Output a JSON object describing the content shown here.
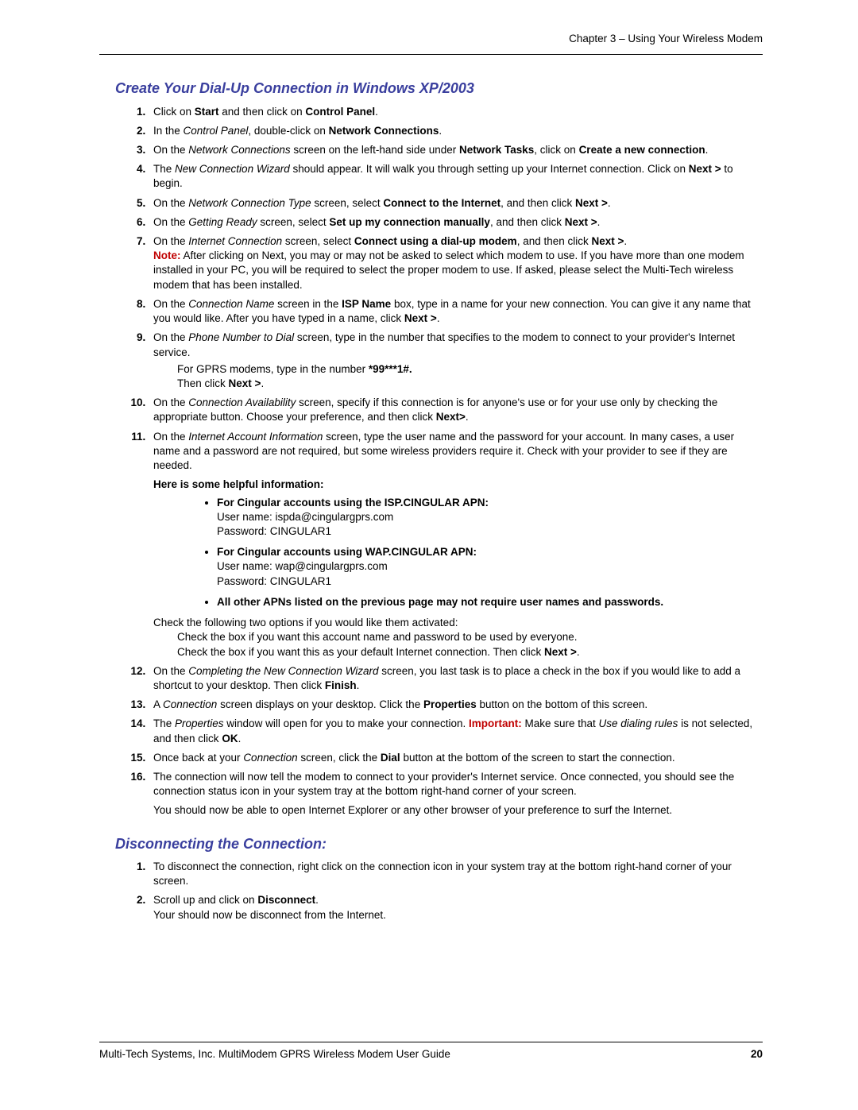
{
  "header": "Chapter 3 – Using Your Wireless Modem",
  "section1_title": "Create Your Dial-Up Connection in Windows XP/2003",
  "s1": {
    "i1a": "Click on ",
    "i1b": "Start",
    "i1c": " and then click on ",
    "i1d": "Control Panel",
    "i1e": ".",
    "i2a": "In the ",
    "i2b": "Control Panel",
    "i2c": ", double-click on ",
    "i2d": "Network Connections",
    "i2e": ".",
    "i3a": "On the ",
    "i3b": "Network Connections",
    "i3c": " screen on the left-hand side under ",
    "i3d": "Network Tasks",
    "i3e": ", click on ",
    "i3f": "Create a new connection",
    "i3g": ".",
    "i4a": "The ",
    "i4b": "New Connection Wizard",
    "i4c": " should appear. It will walk you through setting up your Internet connection. Click on ",
    "i4d": "Next >",
    "i4e": " to begin.",
    "i5a": "On the ",
    "i5b": "Network Connection Type",
    "i5c": " screen, select ",
    "i5d": "Connect to the Internet",
    "i5e": ", and then click ",
    "i5f": "Next >",
    "i5g": ".",
    "i6a": "On the ",
    "i6b": "Getting Ready",
    "i6c": " screen, select ",
    "i6d": "Set up my connection manually",
    "i6e": ", and then click ",
    "i6f": "Next >",
    "i6g": ".",
    "i7a": "On the ",
    "i7b": "Internet Connection",
    "i7c": " screen, select ",
    "i7d": "Connect using a dial-up modem",
    "i7e": ", and then click ",
    "i7f": "Next >",
    "i7g": ".",
    "i7note_label": "Note:",
    "i7note": " After clicking on Next, you may or may not be asked to select which modem to use. If you have more than one modem installed in your PC, you will be required to select the proper modem to use. If asked, please select the Multi-Tech wireless modem that has been installed.",
    "i8a": "On the ",
    "i8b": "Connection Name",
    "i8c": " screen in the ",
    "i8d": "ISP Name",
    "i8e": " box, type in a name for your new connection. You can give it any name that you would like. After you have typed in a name, click ",
    "i8f": "Next >",
    "i8g": ".",
    "i9a": "On the ",
    "i9b": "Phone Number to Dial",
    "i9c": " screen, type in the number that specifies to the modem to connect to your provider's Internet service.",
    "i9sub1a": "For GPRS modems, type in the number ",
    "i9sub1b": "*99***1#.",
    "i9sub2a": "Then click ",
    "i9sub2b": "Next >",
    "i9sub2c": ".",
    "i10a": "On the ",
    "i10b": "Connection Availability",
    "i10c": " screen, specify if this connection is for anyone's use or for your use only by checking the appropriate button. Choose your preference, and then click ",
    "i10d": "Next>",
    "i10e": ".",
    "i11a": "On the ",
    "i11b": "Internet Account Information",
    "i11c": " screen, type the user name and the password for your account. In many cases, a user name and a password are not required, but some wireless providers require it. Check with your provider to see if they are needed.",
    "i11_help": "Here is some helpful information:",
    "b1_title": "For Cingular accounts using the ISP.CINGULAR APN:",
    "b1_user": "User name: ispda@cingulargprs.com",
    "b1_pass": "Password: CINGULAR1",
    "b2_title": "For Cingular accounts using WAP.CINGULAR APN:",
    "b2_user": "User name: wap@cingulargprs.com",
    "b2_pass": "Password: CINGULAR1",
    "b3_title": "All other APNs listed on the previous page may not require user names and passwords.",
    "i11_check_intro": "Check the following two options if you would like them activated:",
    "i11_check1": "Check the box if you want this account name and password to be used by everyone.",
    "i11_check2a": "Check the box if you want this as your default Internet connection. Then click ",
    "i11_check2b": "Next >",
    "i11_check2c": ".",
    "i12a": "On the ",
    "i12b": "Completing the New Connection Wizard",
    "i12c": " screen, you last task is to place a check in the box if you would like to add a shortcut to your desktop. Then click ",
    "i12d": "Finish",
    "i12e": ".",
    "i13a": "A ",
    "i13b": "Connection",
    "i13c": " screen displays on your desktop. Click the ",
    "i13d": "Properties",
    "i13e": " button on the bottom of this screen.",
    "i14a": "The ",
    "i14b": "Properties",
    "i14c": " window will open for you to make your connection. ",
    "i14_imp": "Important:",
    "i14d": " Make sure that ",
    "i14e": "Use dialing rules",
    "i14f": " is not selected, and then click ",
    "i14g": "OK",
    "i14h": ".",
    "i15a": "Once back at your ",
    "i15b": "Connection",
    "i15c": " screen, click the ",
    "i15d": "Dial",
    "i15e": " button at the bottom of the screen to start the connection.",
    "i16a": "The connection will now tell the modem to connect to your provider's Internet service. Once connected, you should see the connection status icon in your system tray at the bottom right-hand corner of your screen.",
    "i16b": "You should now be able to open Internet Explorer or any other browser of your preference to surf the Internet."
  },
  "section2_title": "Disconnecting the Connection:",
  "s2": {
    "i1": "To disconnect the connection, right click on the connection icon in your system tray at the bottom right-hand corner of your screen.",
    "i2a": "Scroll up and click on ",
    "i2b": "Disconnect",
    "i2c": ".",
    "i2d": "Your should now be disconnect from the Internet."
  },
  "footer_text": "Multi-Tech Systems, Inc. MultiModem GPRS Wireless Modem User Guide",
  "footer_page": "20"
}
